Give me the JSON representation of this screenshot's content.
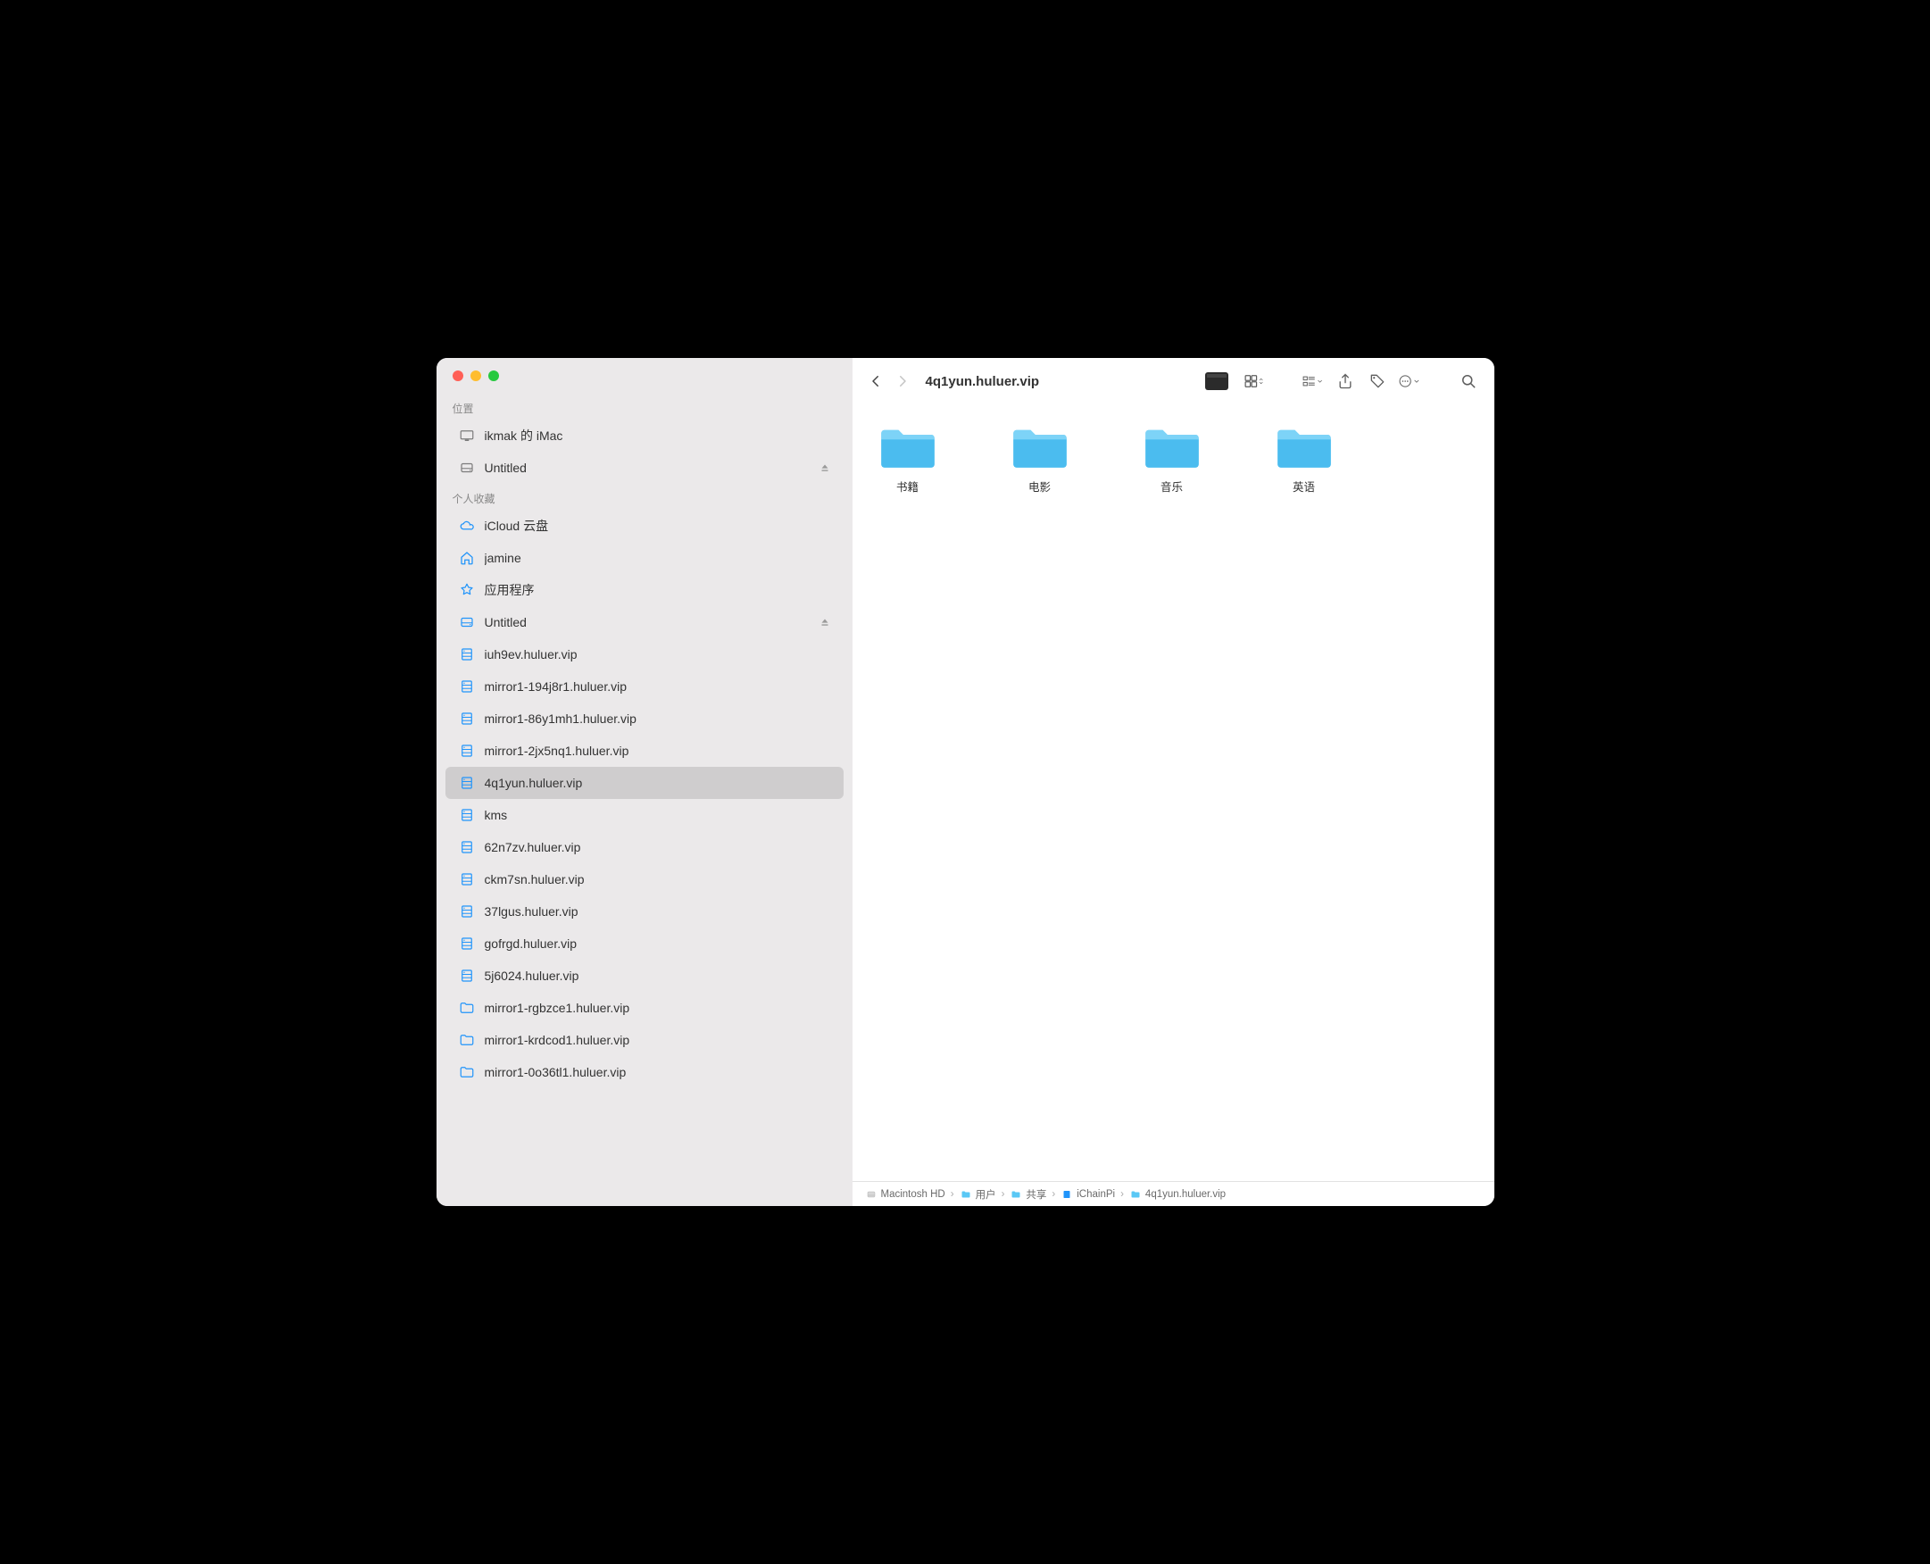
{
  "window": {
    "title": "4q1yun.huluer.vip"
  },
  "sidebar": {
    "sections": [
      {
        "label": "位置",
        "items": [
          {
            "icon": "display",
            "label": "ikmak 的 iMac",
            "eject": false
          },
          {
            "icon": "disk",
            "label": "Untitled",
            "eject": true
          }
        ]
      },
      {
        "label": "个人收藏",
        "items": [
          {
            "icon": "cloud",
            "label": "iCloud 云盘",
            "eject": false
          },
          {
            "icon": "house",
            "label": "jamine",
            "eject": false
          },
          {
            "icon": "app",
            "label": "应用程序",
            "eject": false
          },
          {
            "icon": "disk",
            "label": "Untitled",
            "eject": true
          },
          {
            "icon": "server",
            "label": "iuh9ev.huluer.vip",
            "eject": false
          },
          {
            "icon": "server",
            "label": "mirror1-194j8r1.huluer.vip",
            "eject": false
          },
          {
            "icon": "server",
            "label": "mirror1-86y1mh1.huluer.vip",
            "eject": false
          },
          {
            "icon": "server",
            "label": "mirror1-2jx5nq1.huluer.vip",
            "eject": false
          },
          {
            "icon": "server",
            "label": "4q1yun.huluer.vip",
            "eject": false,
            "selected": true
          },
          {
            "icon": "server",
            "label": "kms",
            "eject": false
          },
          {
            "icon": "server",
            "label": "62n7zv.huluer.vip",
            "eject": false
          },
          {
            "icon": "server",
            "label": "ckm7sn.huluer.vip",
            "eject": false
          },
          {
            "icon": "server",
            "label": "37lgus.huluer.vip",
            "eject": false
          },
          {
            "icon": "server",
            "label": "gofrgd.huluer.vip",
            "eject": false
          },
          {
            "icon": "server",
            "label": "5j6024.huluer.vip",
            "eject": false
          },
          {
            "icon": "folder",
            "label": "mirror1-rgbzce1.huluer.vip",
            "eject": false
          },
          {
            "icon": "folder",
            "label": "mirror1-krdcod1.huluer.vip",
            "eject": false
          },
          {
            "icon": "folder",
            "label": "mirror1-0o36tl1.huluer.vip",
            "eject": false
          }
        ]
      }
    ]
  },
  "folders": [
    {
      "name": "书籍"
    },
    {
      "name": "电影"
    },
    {
      "name": "音乐"
    },
    {
      "name": "英语"
    }
  ],
  "pathbar": [
    {
      "icon": "hd",
      "label": "Macintosh HD"
    },
    {
      "icon": "folder-teal",
      "label": "用户"
    },
    {
      "icon": "folder-teal",
      "label": "共享"
    },
    {
      "icon": "server-sm",
      "label": "iChainPi"
    },
    {
      "icon": "folder-teal",
      "label": "4q1yun.huluer.vip"
    }
  ]
}
